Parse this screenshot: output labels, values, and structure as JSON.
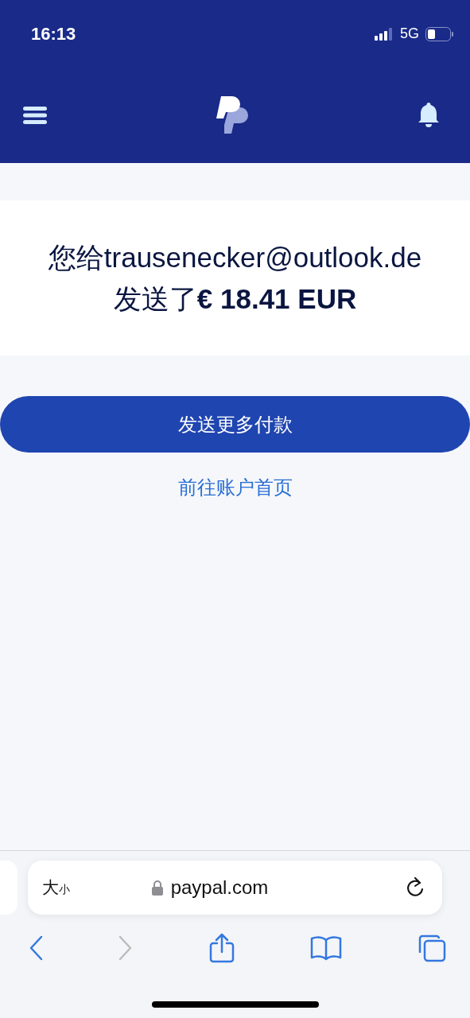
{
  "status_bar": {
    "time": "16:13",
    "network": "5G"
  },
  "message": {
    "line_1": "您给trausenecker@outlook.de",
    "line_2": "发送了**€ 18.41 EUR**"
  },
  "primary_button": "发送更多付款",
  "link": "前往账户首页",
  "address_bar": {
    "text_size_large": "大",
    "text_size_small": "小",
    "url": "paypal.com"
  },
  "toolbar": {
    "back_disabled": false,
    "forward_disabled": true
  }
}
